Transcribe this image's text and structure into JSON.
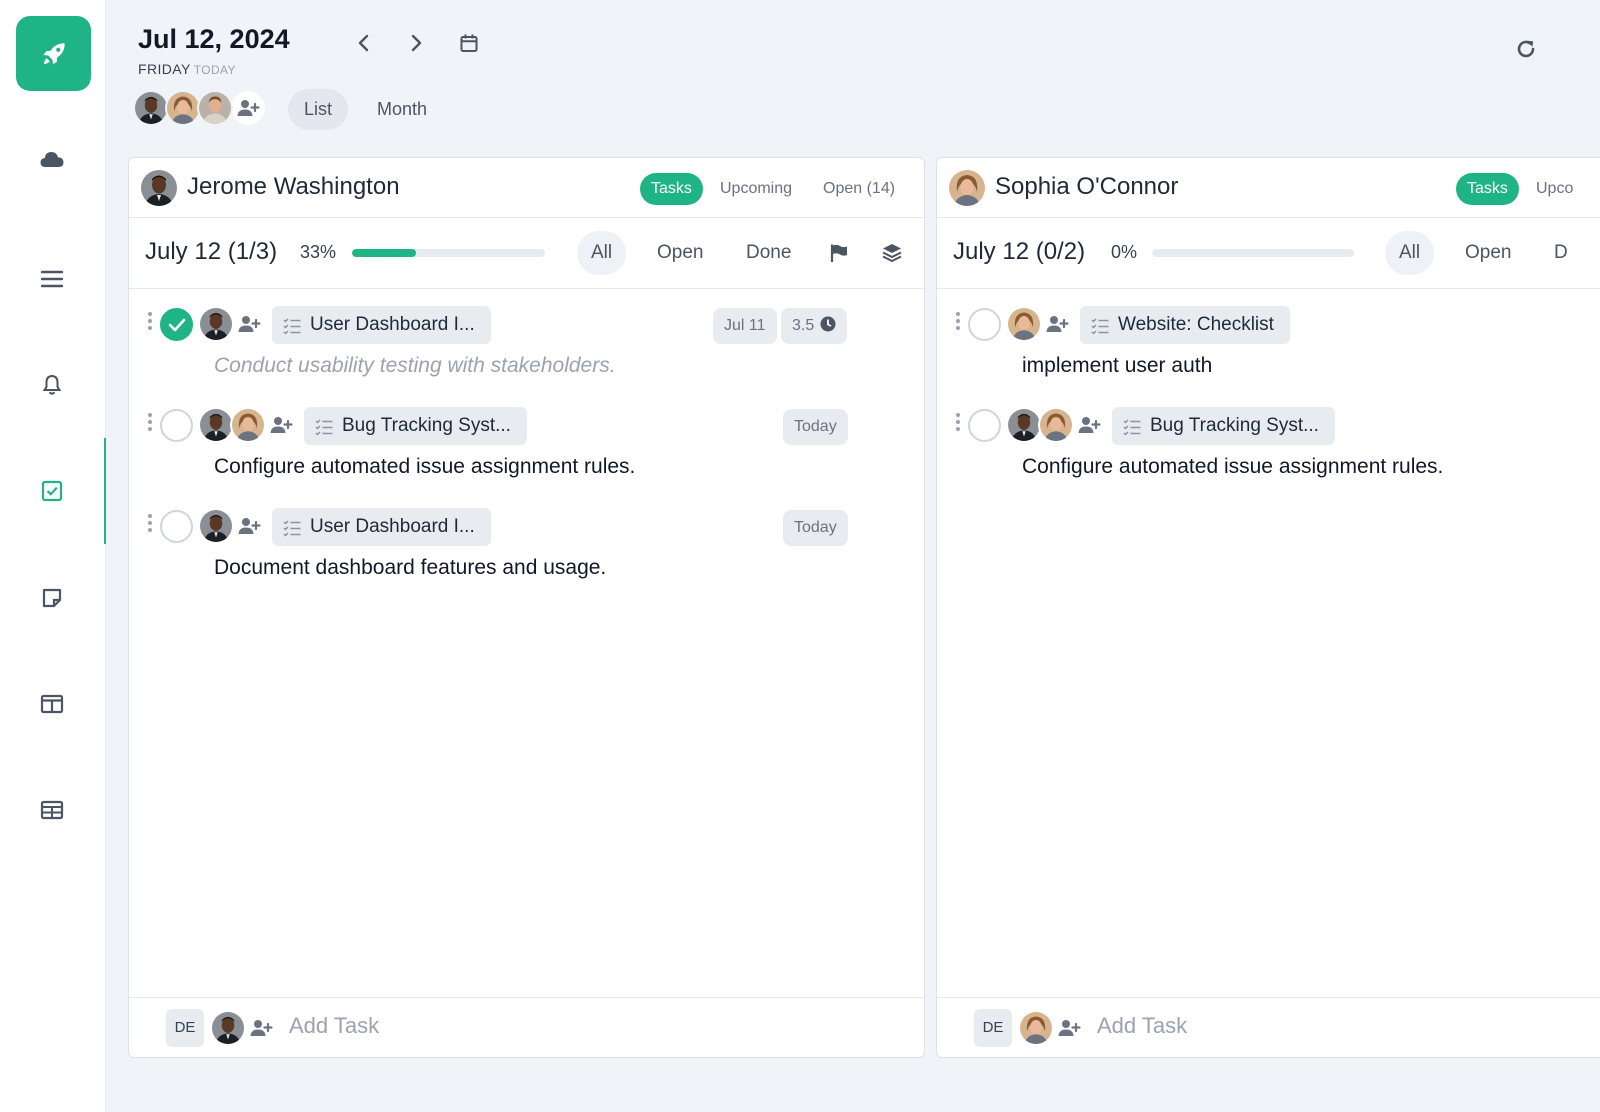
{
  "app": {
    "accent": "#1fb486"
  },
  "sidebar": {
    "items": [
      {
        "icon": "cloud-icon"
      },
      {
        "icon": "menu-icon"
      },
      {
        "icon": "bell-icon"
      },
      {
        "icon": "checkbox-icon",
        "active": true
      },
      {
        "icon": "note-icon"
      },
      {
        "icon": "columns-icon"
      },
      {
        "icon": "table-icon"
      }
    ]
  },
  "header": {
    "date": "Jul 12, 2024",
    "weekday": "FRIDAY",
    "today_label": "TODAY",
    "views": [
      "List",
      "Month"
    ],
    "active_view": "List"
  },
  "panels": [
    {
      "owner": "Jerome Washington",
      "tabs": [
        "Tasks",
        "Upcoming",
        "Open (14)"
      ],
      "active_tab": "Tasks",
      "day_label": "July 12 (1/3)",
      "progress_label": "33%",
      "progress": 0.33,
      "filters": [
        "All",
        "Open",
        "Done"
      ],
      "active_filter": "All",
      "tasks": [
        {
          "done": true,
          "project": "User Dashboard I...",
          "chips": [
            "Jul 11",
            "3.5"
          ],
          "description": "Conduct usability testing with stakeholders."
        },
        {
          "done": false,
          "project": "Bug Tracking Syst...",
          "chips": [
            "Today"
          ],
          "description": "Configure automated issue assignment rules."
        },
        {
          "done": false,
          "project": "User Dashboard I...",
          "chips": [
            "Today"
          ],
          "description": "Document dashboard features and usage."
        }
      ],
      "footer": {
        "initials": "DE",
        "placeholder": "Add Task"
      }
    },
    {
      "owner": "Sophia O'Connor",
      "tabs": [
        "Tasks",
        "Upco"
      ],
      "active_tab": "Tasks",
      "day_label": "July 12 (0/2)",
      "progress_label": "0%",
      "progress": 0,
      "filters": [
        "All",
        "Open",
        "D"
      ],
      "active_filter": "All",
      "tasks": [
        {
          "done": false,
          "project": "Website: Checklist",
          "chips": [],
          "description": "implement user auth"
        },
        {
          "done": false,
          "project": "Bug Tracking Syst...",
          "chips": [],
          "description": "Configure automated issue assignment rules."
        }
      ],
      "footer": {
        "initials": "DE",
        "placeholder": "Add Task"
      }
    }
  ]
}
